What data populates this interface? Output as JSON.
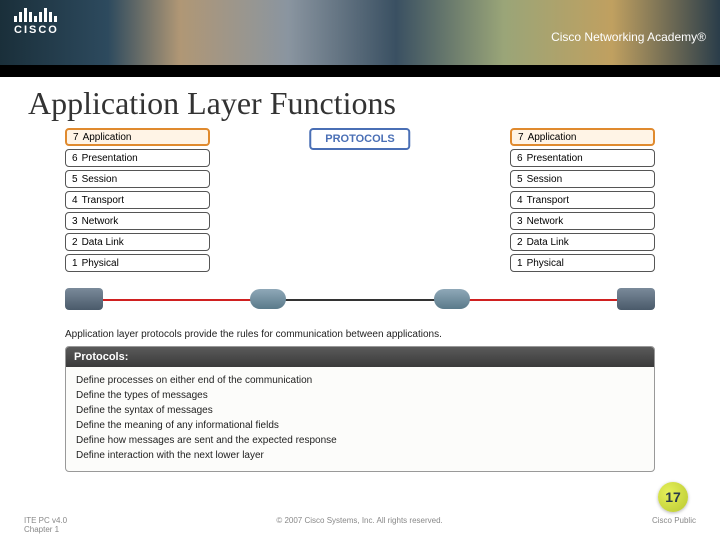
{
  "header": {
    "logo_text": "CISCO",
    "academy_text": "Cisco Networking Academy®"
  },
  "title": "Application Layer Functions",
  "osi_layers": [
    {
      "num": "7",
      "name": "Application",
      "highlight": true
    },
    {
      "num": "6",
      "name": "Presentation",
      "highlight": false
    },
    {
      "num": "5",
      "name": "Session",
      "highlight": false
    },
    {
      "num": "4",
      "name": "Transport",
      "highlight": false
    },
    {
      "num": "3",
      "name": "Network",
      "highlight": false
    },
    {
      "num": "2",
      "name": "Data Link",
      "highlight": false
    },
    {
      "num": "1",
      "name": "Physical",
      "highlight": false
    }
  ],
  "protocols_label": "PROTOCOLS",
  "caption": "Application layer protocols provide the rules for communication between applications.",
  "panel": {
    "heading": "Protocols:",
    "items": [
      "Define processes on either end of the communication",
      "Define the types of messages",
      "Define the syntax of messages",
      "Define the meaning of any informational fields",
      "Define how messages are sent and the expected response",
      "Define interaction with the next lower layer"
    ]
  },
  "page_number": "17",
  "footer": {
    "left_line1": "ITE PC v4.0",
    "left_line2": "Chapter 1",
    "center": "© 2007 Cisco Systems, Inc. All rights reserved.",
    "right": "Cisco Public"
  }
}
